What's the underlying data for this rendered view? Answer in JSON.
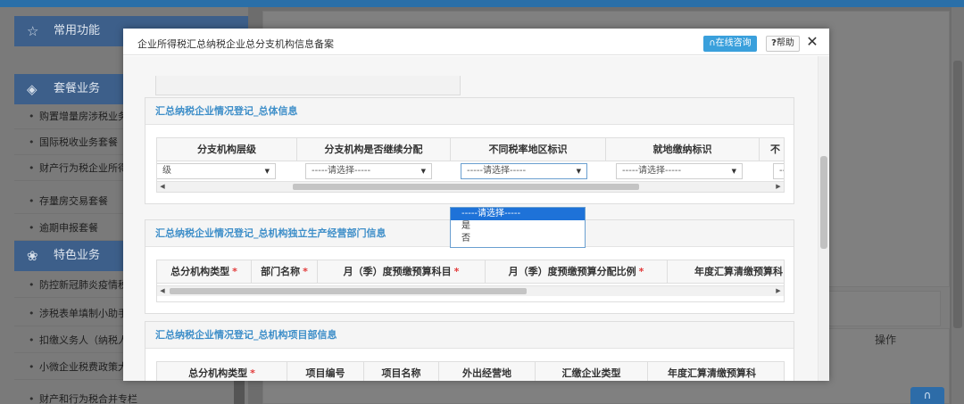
{
  "sidebar": {
    "sections": [
      {
        "label": "常用功能",
        "icon": "star-icon"
      },
      {
        "label": "套餐业务",
        "icon": "stack-icon"
      },
      {
        "label": "特色业务",
        "icon": "cluster-icon"
      }
    ],
    "package_items": [
      "购置增量房涉税业务",
      "国际税收业务套餐",
      "财产行为税企业所得税",
      "存量房交易套餐",
      "逾期申报套餐"
    ],
    "feature_items": [
      "防控新冠肺炎疫情税",
      "涉税表单填制小助手",
      "扣缴义务人（纳税人",
      "小微企业税费政策大",
      "财产和行为税合并专栏"
    ]
  },
  "background": {
    "op_header": "操作"
  },
  "modal": {
    "title": "企业所得税汇总纳税企业总分支机构信息备案",
    "online_consult": "在线咨询",
    "help_label": "帮助",
    "close_glyph": "✕"
  },
  "panels": [
    {
      "title": "汇总纳税企业情况登记_总体信息",
      "columns": [
        {
          "label": "分支机构层级",
          "required": false
        },
        {
          "label": "分支机构是否继续分配",
          "required": false
        },
        {
          "label": "不同税率地区标识",
          "required": false
        },
        {
          "label": "就地缴纳标识",
          "required": false
        },
        {
          "label": "不",
          "required": false
        }
      ],
      "row": [
        "级",
        "-----请选择-----",
        "-----请选择-----",
        "-----请选择-----",
        "---"
      ]
    },
    {
      "title": "汇总纳税企业情况登记_总机构独立生产经营部门信息",
      "columns": [
        {
          "label": "总分机构类型",
          "required": true
        },
        {
          "label": "部门名称",
          "required": true
        },
        {
          "label": "月（季）度预缴预算科目",
          "required": true
        },
        {
          "label": "月（季）度预缴预算分配比例",
          "required": true
        },
        {
          "label": "年度汇算清缴预算科",
          "required": false
        }
      ]
    },
    {
      "title": "汇总纳税企业情况登记_总机构项目部信息",
      "columns": [
        {
          "label": "总分机构类型",
          "required": true
        },
        {
          "label": "项目编号",
          "required": false
        },
        {
          "label": "项目名称",
          "required": false
        },
        {
          "label": "外出经营地",
          "required": false
        },
        {
          "label": "汇缴企业类型",
          "required": false
        },
        {
          "label": "年度汇算清缴预算科",
          "required": false
        }
      ]
    }
  ],
  "dropdown": {
    "options": [
      "-----请选择-----",
      "是",
      "否"
    ],
    "selected_index": 0
  },
  "colors": {
    "accent": "#3f8fc9",
    "required": "#e23a3a",
    "selected": "#1e72d8"
  }
}
